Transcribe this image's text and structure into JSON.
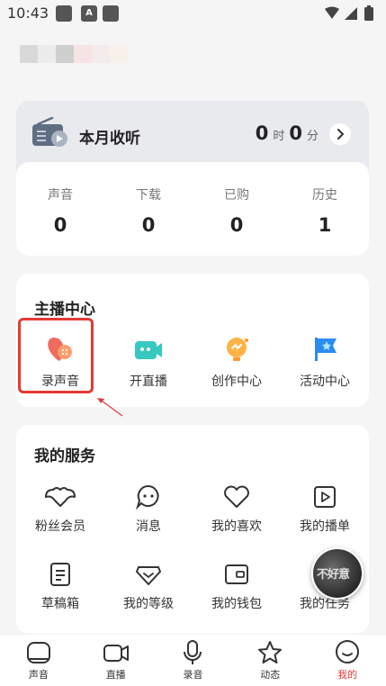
{
  "status_bar": {
    "time": "10:43",
    "badge": "A"
  },
  "listen": {
    "title": "本月收听",
    "hours": "0",
    "hours_unit": "时",
    "minutes": "0",
    "minutes_unit": "分",
    "stats": [
      {
        "label": "声音",
        "value": "0"
      },
      {
        "label": "下载",
        "value": "0"
      },
      {
        "label": "已购",
        "value": "0"
      },
      {
        "label": "历史",
        "value": "1"
      }
    ]
  },
  "anchor_center": {
    "title": "主播中心",
    "items": [
      {
        "label": "录声音",
        "icon": "record-sound-icon"
      },
      {
        "label": "开直播",
        "icon": "live-camera-icon"
      },
      {
        "label": "创作中心",
        "icon": "creation-bulb-icon"
      },
      {
        "label": "活动中心",
        "icon": "flag-star-icon"
      }
    ]
  },
  "services": {
    "title": "我的服务",
    "items": [
      {
        "label": "粉丝会员",
        "icon": "fan-member-icon"
      },
      {
        "label": "消息",
        "icon": "message-icon"
      },
      {
        "label": "我的喜欢",
        "icon": "heart-icon"
      },
      {
        "label": "我的播单",
        "icon": "playlist-icon"
      },
      {
        "label": "草稿箱",
        "icon": "draft-icon"
      },
      {
        "label": "我的等级",
        "icon": "level-diamond-icon"
      },
      {
        "label": "我的钱包",
        "icon": "wallet-icon"
      },
      {
        "label": "我的任务",
        "icon": "task-icon"
      }
    ]
  },
  "avatar_text": "不好意",
  "bottom_nav": [
    {
      "label": "声音",
      "icon": "sound-home-icon",
      "active": false
    },
    {
      "label": "直播",
      "icon": "live-icon",
      "active": false
    },
    {
      "label": "录音",
      "icon": "microphone-icon",
      "active": false
    },
    {
      "label": "动态",
      "icon": "star-icon",
      "active": false
    },
    {
      "label": "我的",
      "icon": "profile-icon",
      "active": true
    }
  ],
  "colors": {
    "accent": "#e53935",
    "highlight_box": "#e53935",
    "teal": "#37c8c0",
    "orange": "#ff9b2f",
    "blue": "#2b8cf0"
  }
}
